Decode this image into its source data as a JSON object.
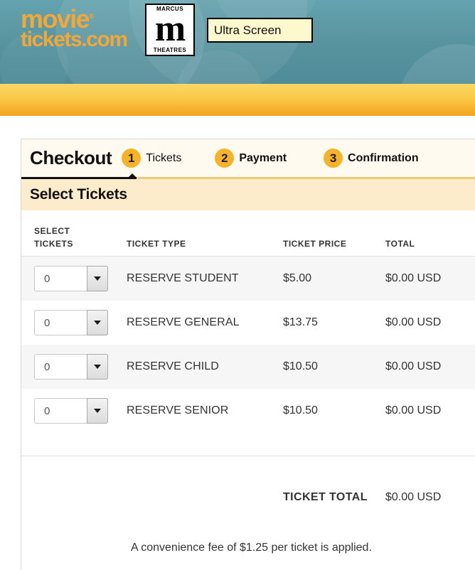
{
  "header": {
    "brand": {
      "line1": "movie",
      "trademark": "®",
      "line2": "tickets.com"
    },
    "theatre_logo": {
      "top_word": "MARCUS",
      "monogram": "m",
      "bottom_word": "THEATRES"
    },
    "screen_badge": "Ultra Screen"
  },
  "checkout": {
    "title": "Checkout",
    "steps": [
      {
        "number": "1",
        "label": "Tickets",
        "active": true
      },
      {
        "number": "2",
        "label": "Payment",
        "active": false
      },
      {
        "number": "3",
        "label": "Confirmation",
        "active": false
      }
    ],
    "section_title": "Select Tickets"
  },
  "table": {
    "headers": {
      "qty_line1": "SELECT",
      "qty_line2": "TICKETS",
      "type": "TICKET TYPE",
      "price": "TICKET PRICE",
      "total": "TOTAL"
    },
    "rows": [
      {
        "qty": "0",
        "type": "RESERVE STUDENT",
        "price": "$5.00",
        "total": "$0.00 USD"
      },
      {
        "qty": "0",
        "type": "RESERVE GENERAL",
        "price": "$13.75",
        "total": "$0.00 USD"
      },
      {
        "qty": "0",
        "type": "RESERVE CHILD",
        "price": "$10.50",
        "total": "$0.00 USD"
      },
      {
        "qty": "0",
        "type": "RESERVE SENIOR",
        "price": "$10.50",
        "total": "$0.00 USD"
      }
    ],
    "ticket_total_label": "TICKET TOTAL",
    "ticket_total_value": "$0.00 USD",
    "fee_note": "A convenience fee of $1.25 per ticket is applied."
  },
  "colors": {
    "teal_banner": "#57939f",
    "orange_bar_top": "#fbd764",
    "orange_bar_bottom": "#f4a623",
    "step_badge": "#f7b326",
    "brand_orange": "#f2a838",
    "section_banner": "#fceccb",
    "steps_bar": "#fffaf0"
  }
}
